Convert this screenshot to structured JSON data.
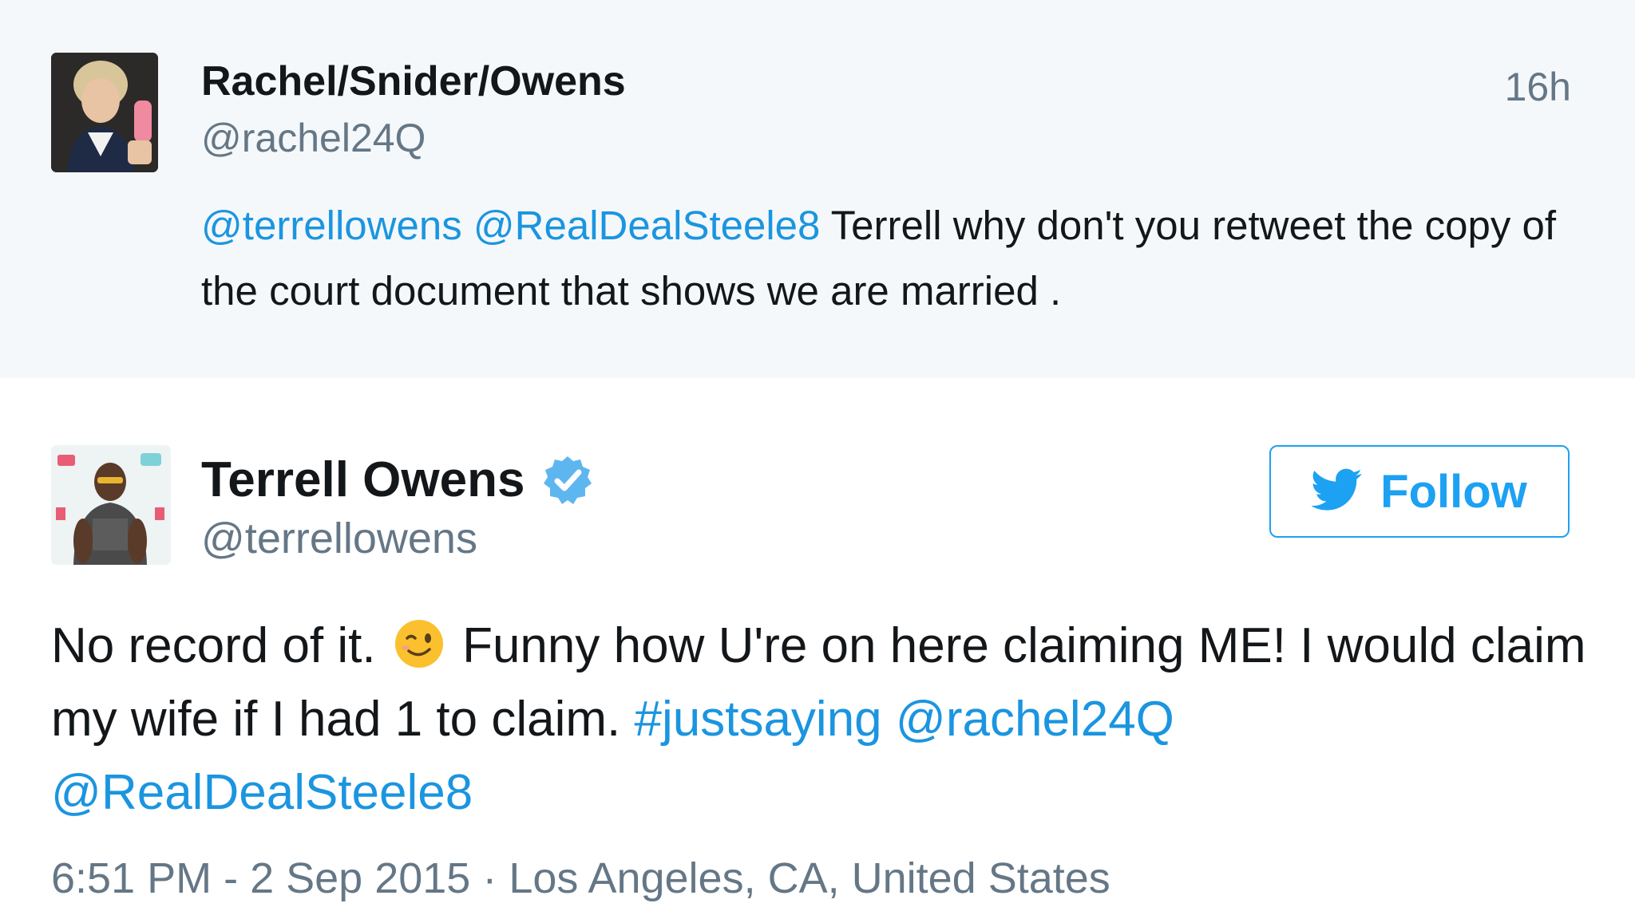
{
  "reply": {
    "display_name": "Rachel/Snider/Owens",
    "handle": "@rachel24Q",
    "time": "16h",
    "avatar_icon": "user-photo",
    "mentions": [
      "@terrellowens",
      "@RealDealSteele8"
    ],
    "text": "Terrell why don't you retweet the copy of the court document that shows we are married ."
  },
  "tweet": {
    "display_name": "Terrell Owens",
    "verified_icon": "verified-badge",
    "handle": "@terrellowens",
    "avatar_icon": "user-photo",
    "follow_icon": "twitter-bird",
    "follow_label": "Follow",
    "text_part1": "No record of it.",
    "emoji": "winking-face",
    "text_part2": "Funny how U're on here claiming ME!  I would claim my wife if I had 1 to claim.",
    "hashtag": "#justsaying",
    "mentions": [
      "@rachel24Q",
      "@RealDealSteele8"
    ],
    "time": "6:51 PM - 2 Sep 2015",
    "separator": "·",
    "location": "Los Angeles, CA, United States"
  },
  "colors": {
    "link": "#1b95e0",
    "brand": "#1da1f2",
    "secondary_text": "#657786",
    "reply_background": "#f5f8fa"
  }
}
